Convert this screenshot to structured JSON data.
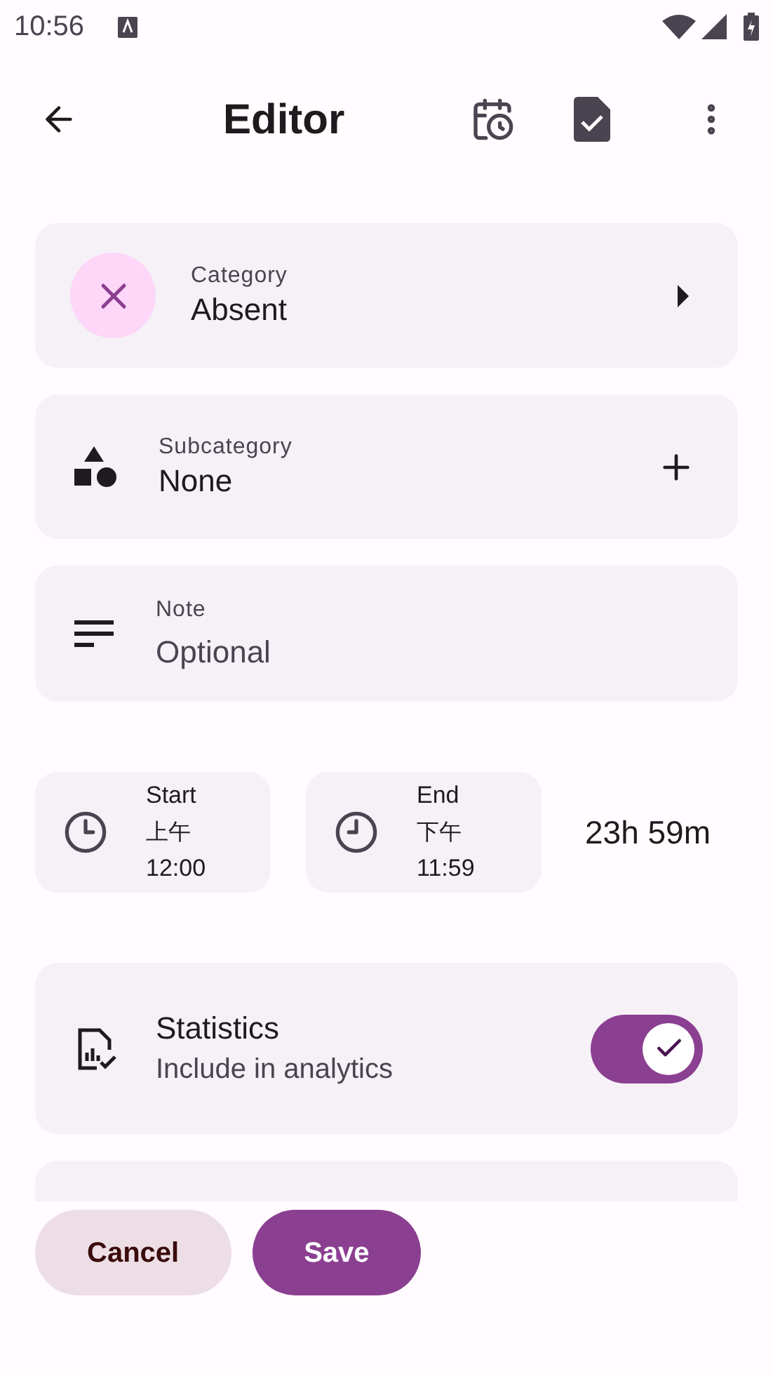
{
  "status_bar": {
    "time": "10:56"
  },
  "app_bar": {
    "title": "Editor"
  },
  "fields": [
    {
      "kind": "category",
      "label": "Category",
      "value": "Absent"
    },
    {
      "kind": "subcategory",
      "label": "Subcategory",
      "value": "None"
    },
    {
      "kind": "note",
      "label": "Note",
      "placeholder": "Optional"
    }
  ],
  "times": [
    {
      "label": "Start",
      "period": "上午",
      "time": "12:00"
    },
    {
      "label": "End",
      "period": "下午",
      "time": "11:59"
    }
  ],
  "duration": "23h 59m",
  "statistics": {
    "title": "Statistics",
    "subtitle": "Include in analytics",
    "on": true
  },
  "buttons": [
    {
      "kind": "tonal",
      "label": "Cancel"
    },
    {
      "kind": "filled",
      "label": "Save"
    }
  ]
}
